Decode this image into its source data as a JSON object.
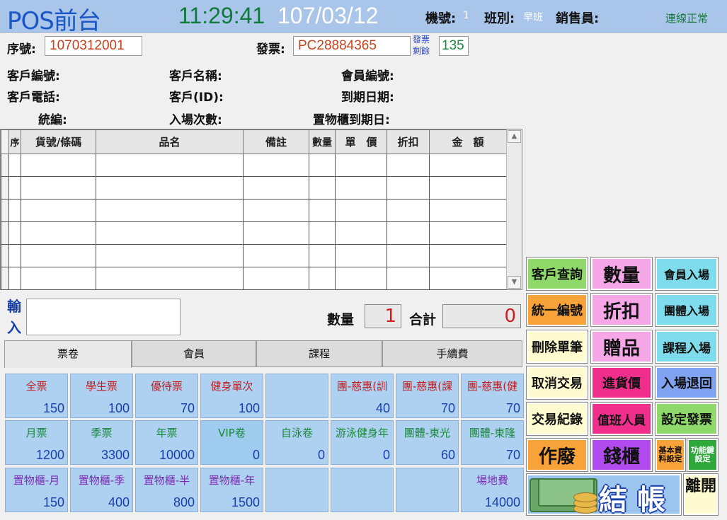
{
  "header": {
    "app_title": "POS前台",
    "time": "11:29:41",
    "date": "107/03/12",
    "machine_label": "機號:",
    "machine_value": "1",
    "shift_label": "班別:",
    "shift_value": "早班",
    "salesperson_label": "銷售員:",
    "salesperson_value": "",
    "connection_status": "連線正常"
  },
  "order": {
    "serial_label": "序號:",
    "serial_value": "1070312001",
    "invoice_label": "發票:",
    "invoice_value": "PC28884365",
    "invoice_remain_label": "發票剩餘",
    "invoice_remain_value": "135"
  },
  "customer": {
    "code_label": "客戶編號:",
    "name_label": "客戶名稱:",
    "member_no_label": "會員編號:",
    "phone_label": "客戶電話:",
    "id_label": "客戶(ID):",
    "expiry_label": "到期日期:",
    "tax_id_label": "統編:",
    "entry_count_label": "入場次數:",
    "locker_expiry_label": "置物櫃到期日:"
  },
  "grid": {
    "columns": [
      "序",
      "貨號/條碼",
      "品名",
      "備註",
      "數量",
      "單　價",
      "折扣",
      "金　額"
    ],
    "empty_rows": 6
  },
  "entry": {
    "input_label": "輸入",
    "input_value": "",
    "qty_label": "數量",
    "qty_value": "1",
    "total_label": "合計",
    "total_value": "0"
  },
  "tabs": [
    "票卷",
    "會員",
    "課程",
    "手續費"
  ],
  "active_tab": "票卷",
  "tickets": [
    {
      "name": "全票",
      "price": "150"
    },
    {
      "name": "學生票",
      "price": "100"
    },
    {
      "name": "優待票",
      "price": "70"
    },
    {
      "name": "健身單次",
      "price": "100"
    },
    {
      "name": "",
      "price": ""
    },
    {
      "name": "團-慈惠(訓",
      "price": "40"
    },
    {
      "name": "團-慈惠(課",
      "price": "70"
    },
    {
      "name": "團-慈惠(健",
      "price": "70"
    },
    {
      "name": "月票",
      "price": "1200"
    },
    {
      "name": "季票",
      "price": "3300"
    },
    {
      "name": "年票",
      "price": "10000"
    },
    {
      "name": "VIP卷",
      "price": "0"
    },
    {
      "name": "自泳卷",
      "price": "0"
    },
    {
      "name": "游泳健身年",
      "price": "0"
    },
    {
      "name": "團體-東光",
      "price": "60"
    },
    {
      "name": "團體-東隆",
      "price": "70"
    },
    {
      "name": "置物櫃-月",
      "price": "150"
    },
    {
      "name": "置物櫃-季",
      "price": "400"
    },
    {
      "name": "置物櫃-半",
      "price": "800"
    },
    {
      "name": "置物櫃-年",
      "price": "1500"
    },
    {
      "name": "",
      "price": ""
    },
    {
      "name": "",
      "price": ""
    },
    {
      "name": "",
      "price": ""
    },
    {
      "name": "場地費",
      "price": "14000"
    }
  ],
  "actions": {
    "customer_query": "客戶查詢",
    "quantity": "數量",
    "member_entry": "會員入場",
    "tax_id": "統一編號",
    "discount": "折扣",
    "group_entry": "團體入場",
    "delete_item": "刪除單筆",
    "gift": "贈品",
    "course_entry": "課程入場",
    "cancel_transaction": "取消交易",
    "purchase_price": "進貨價",
    "entry_refund": "入場退回",
    "transaction_log": "交易紀錄",
    "duty_staff": "值班人員",
    "set_invoice": "設定發票",
    "void": "作廢",
    "cash_drawer": "錢櫃",
    "basic_settings": "基本資料設定",
    "function_keys": "功能鍵設定",
    "checkout": "結帳",
    "leave": "離開"
  },
  "colors": {
    "header_bg": "#a9c6ea",
    "green_btn": "#8fd86a",
    "pink_btn": "#f5a7e8",
    "cyan_btn": "#7fdcec",
    "orange_btn": "#f8a33a",
    "magenta_btn": "#f02f8d",
    "blue_btn": "#7fa3f0",
    "yellow_btn": "#fffbd0",
    "purple_btn": "#b24cf0"
  }
}
